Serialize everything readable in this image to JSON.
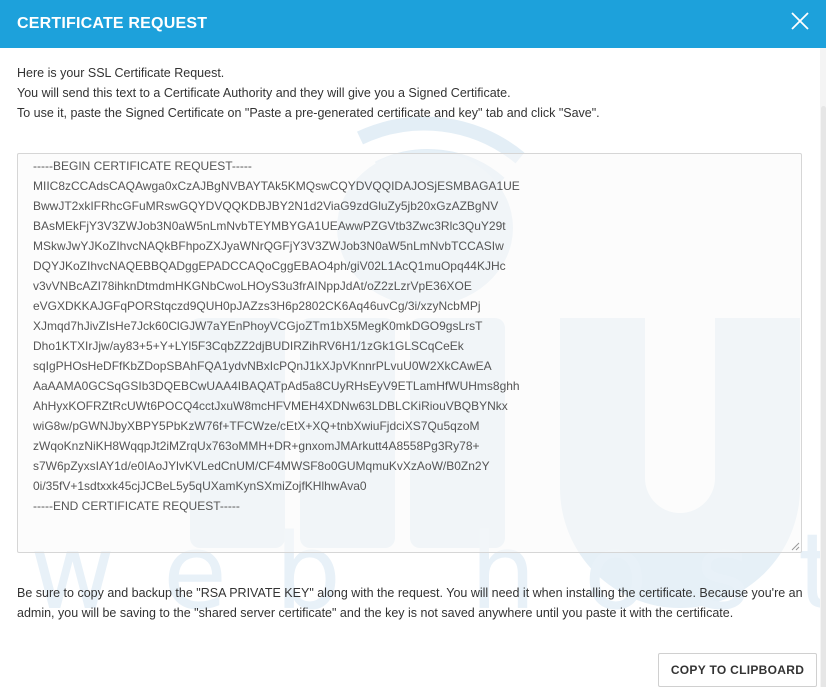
{
  "modal": {
    "title": "CERTIFICATE REQUEST",
    "close_icon": "close-icon"
  },
  "intro": {
    "line1": "Here is your SSL Certificate Request.",
    "line2": "You will send this text to a Certificate Authority and they will give you a Signed Certificate.",
    "line3": "To use it, paste the Signed Certificate on \"Paste a pre-generated certificate and key\" tab and click \"Save\"."
  },
  "csr": {
    "lines": [
      "-----BEGIN CERTIFICATE REQUEST-----",
      "MIIC8zCCAdsCAQAwga0xCzAJBgNVBAYTAk5KMQswCQYDVQQIDAJOSjESMBAGA1UE",
      "BwwJT2xkIFRhcGFuMRswGQYDVQQKDBJBY2N1d2ViaG9zdGluZy5jb20xGzAZBgNV",
      "BAsMEkFjY3V3ZWJob3N0aW5nLmNvbTEYMBYGA1UEAwwPZGVtb3Zwc3Rlc3QuY29t",
      "MSkwJwYJKoZIhvcNAQkBFhpoZXJyaWNrQGFjY3V3ZWJob3N0aW5nLmNvbTCCASIw",
      "DQYJKoZIhvcNAQEBBQADggEPADCCAQoCggEBAO4ph/giV02L1AcQ1muOpq44KJHc",
      "v3vVNBcAZI78ihknDtmdmHKGNbCwoLHOyS3u3frAINppJdAt/oZ2zLzrVpE36XOE",
      "eVGXDKKAJGFqPORStqczd9QUH0pJAZzs3H6p2802CK6Aq46uvCg/3i/xzyNcbMPj",
      "XJmqd7hJivZIsHe7Jck60ClGJW7aYEnPhoyVCGjoZTm1bX5MegK0mkDGO9gsLrsT",
      "Dho1KTXIrJjw/ay83+5+Y+LYl5F3CqbZZ2djBUDIRZihRV6H1/1zGk1GLSCqCeEk",
      "sqIgPHOsHeDFfKbZDopSBAhFQA1ydvNBxIcPQnJ1kXJpVKnnrPLvuU0W2XkCAwEA",
      "AaAAMA0GCSqGSIb3DQEBCwUAA4IBAQATpAd5a8CUyRHsEyV9ETLamHfWUHms8ghh",
      "AhHyxKOFRZtRcUWt6POCQ4cctJxuW8mcHFVMEH4XDNw63LDBLCKiRiouVBQBYNkx",
      "wiG8w/pGWNJbyXBPY5PbKzW76f+TFCWze/cEtX+XQ+tnbXwiuFjdciXS7Qu5qzoM",
      "zWqoKnzNiKH8WqqpJt2iMZrqUx763oMMH+DR+gnxomJMArkutt4A8558Pg3Ry78+",
      "s7W6pZyxsIAY1d/e0IAoJYlvKVLedCnUM/CF4MWSF8o0GUMqmuKvXzAoW/B0Zn2Y",
      "0i/35fV+1sdtxxk45cjJCBeL5y5qUXamKynSXmiZojfKHlhwAva0",
      "-----END CERTIFICATE REQUEST-----"
    ]
  },
  "footer": {
    "note": "Be sure to copy and backup the \"RSA PRIVATE KEY\" along with the request. You will need it when installing the certificate. Because you're an admin, you will be saving to the \"shared server certificate\" and the key is not saved anywhere until you paste it with the certificate.",
    "copy_label": "COPY TO CLIPBOARD"
  },
  "colors": {
    "header_bg": "#1da1db",
    "watermark": "#e3eef6"
  },
  "watermark": {
    "text": "web hosting",
    "logo_icon": "wifi-cloud-icon"
  }
}
